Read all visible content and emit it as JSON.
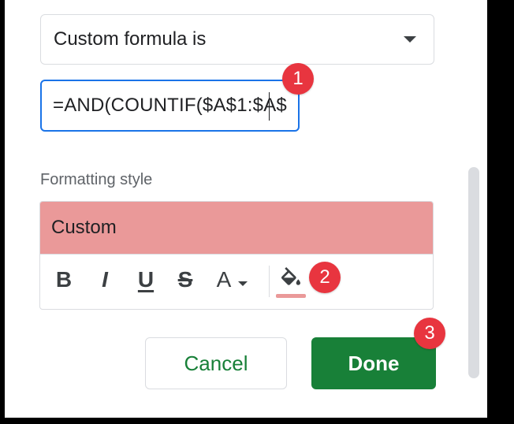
{
  "condition": {
    "dropdown_value": "Custom formula is",
    "formula_value": "=AND(COUNTIF($A$1:$A$"
  },
  "formatting": {
    "label": "Formatting style",
    "preview_text": "Custom",
    "preview_color": "#ea9999",
    "toolbar": {
      "bold": "B",
      "italic": "I",
      "underline": "U",
      "strikethrough": "S",
      "text_color": "A"
    }
  },
  "actions": {
    "cancel_label": "Cancel",
    "done_label": "Done"
  },
  "annotations": [
    "1",
    "2",
    "3"
  ],
  "colors": {
    "accent_blue": "#1a73e8",
    "primary_green": "#188038",
    "badge_red": "#e8353f"
  }
}
